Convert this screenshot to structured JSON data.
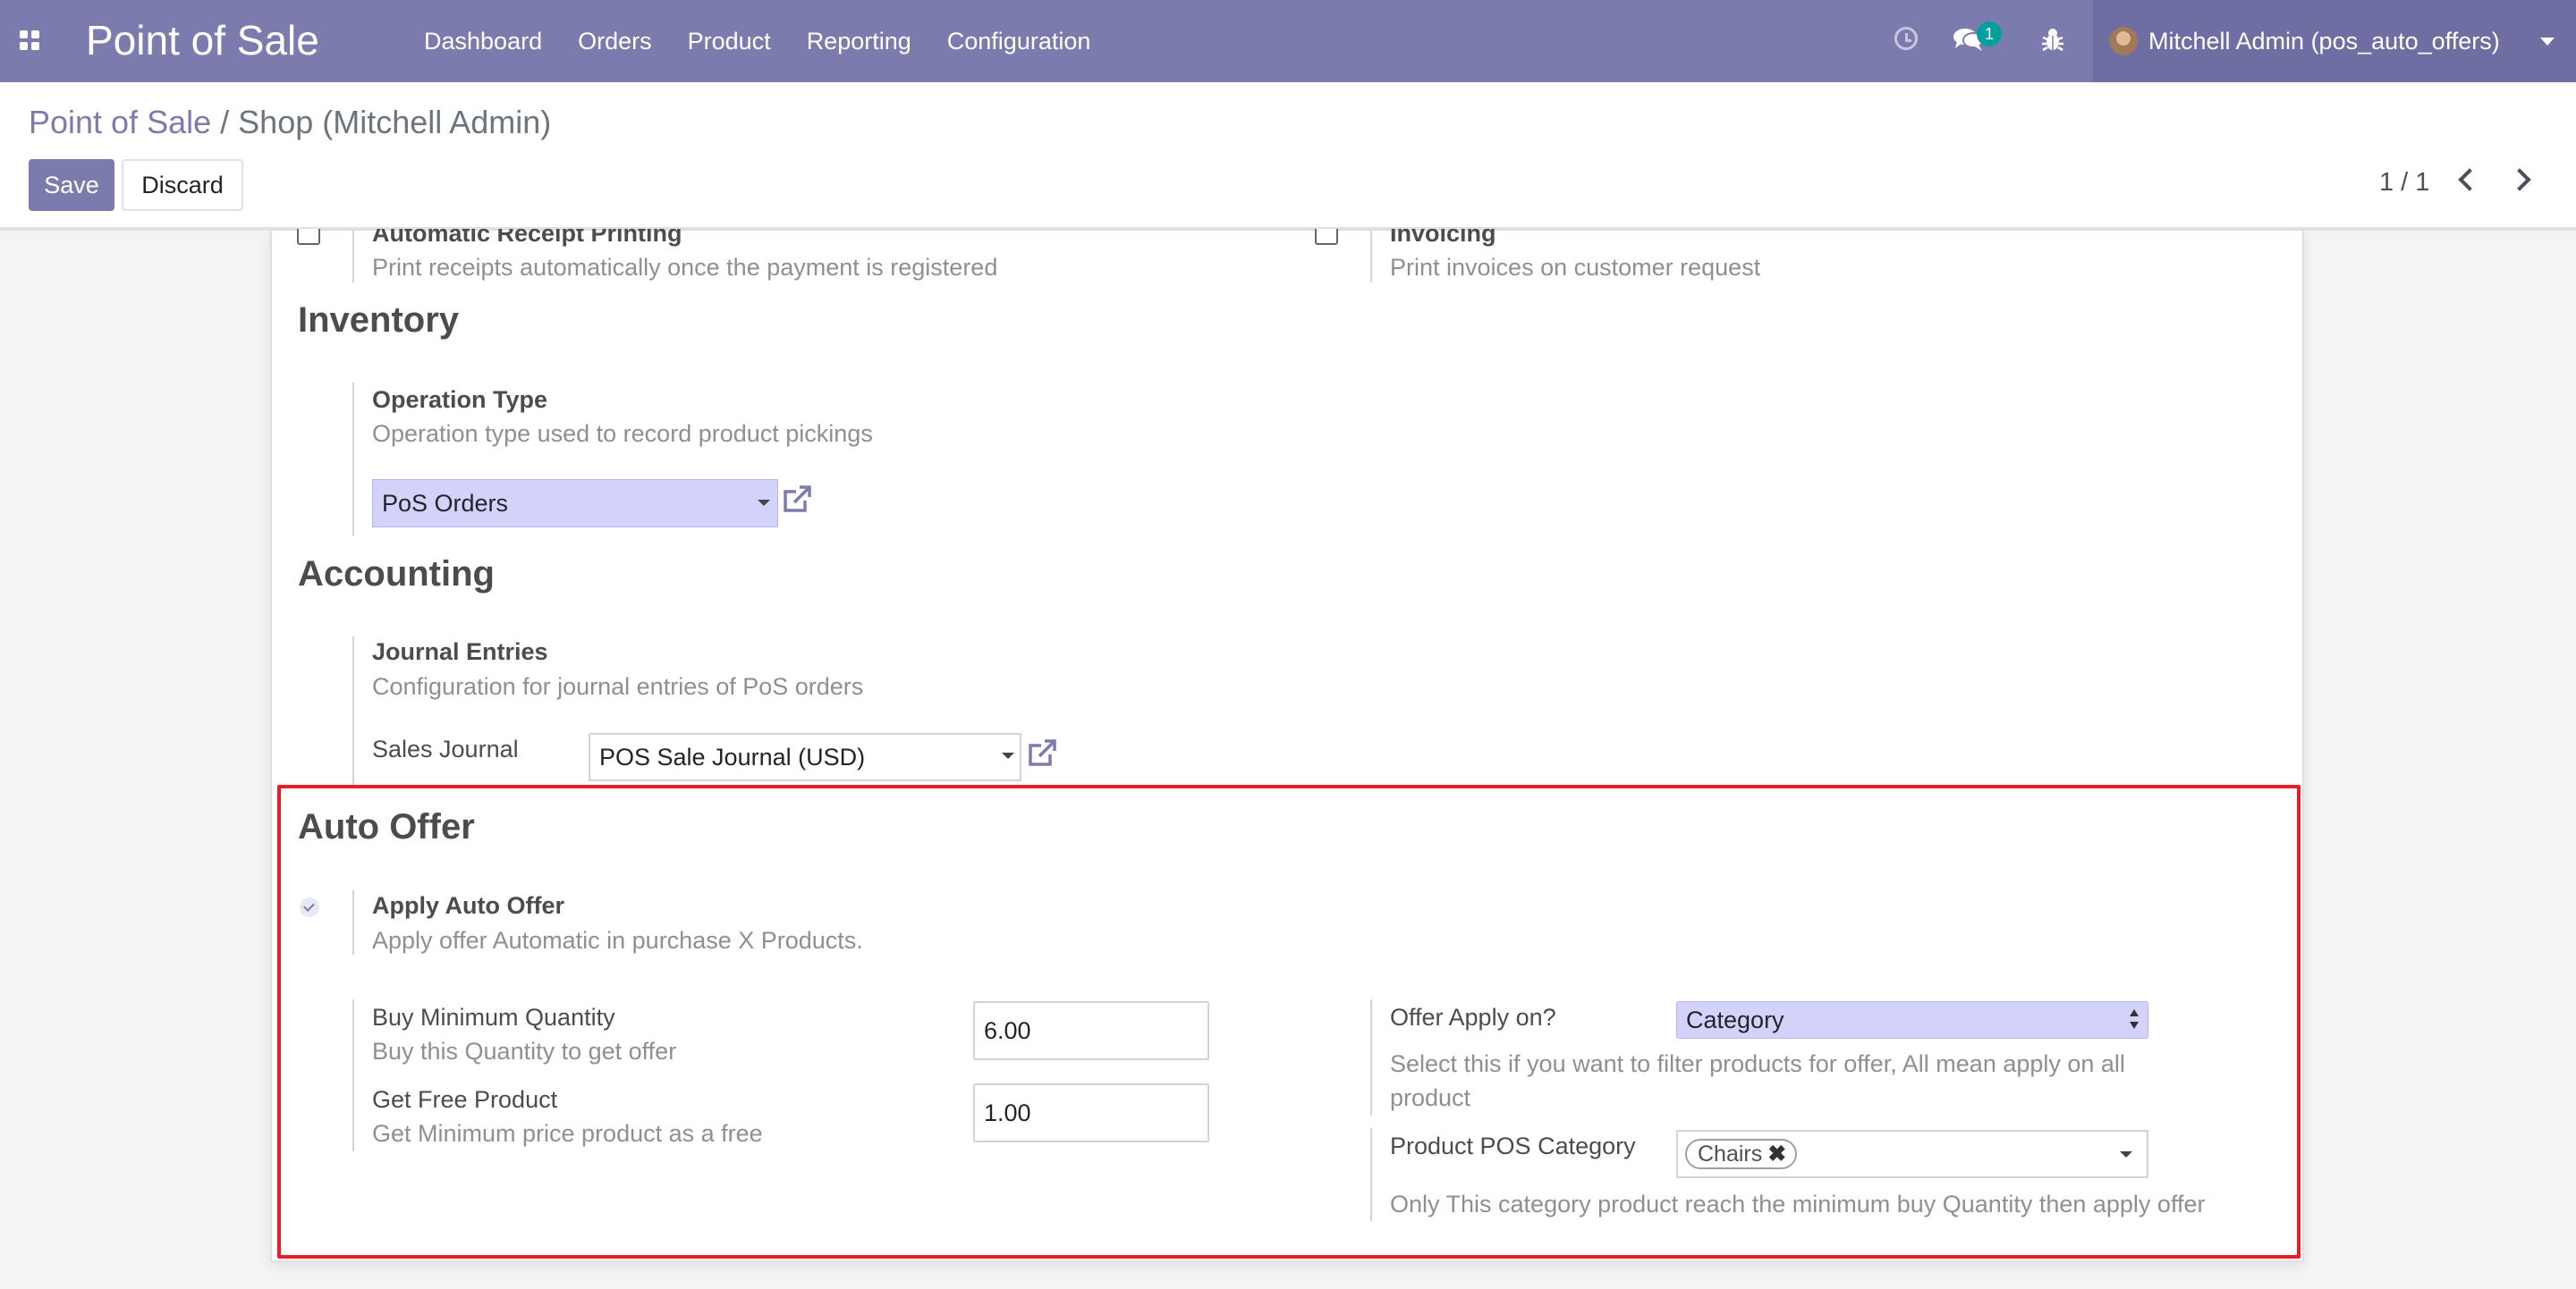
{
  "navbar": {
    "brand": "Point of Sale",
    "menu": [
      "Dashboard",
      "Orders",
      "Product",
      "Reporting",
      "Configuration"
    ],
    "messages_count": "1",
    "user_name": "Mitchell Admin (pos_auto_offers)",
    "color": "#7c7bad"
  },
  "breadcrumb": {
    "parent": "Point of Sale",
    "separator": "/",
    "current": "Shop (Mitchell Admin)"
  },
  "actions": {
    "save_label": "Save",
    "discard_label": "Discard"
  },
  "pager": {
    "value": "1 / 1"
  },
  "receipt": {
    "auto_print_title": "Automatic Receipt Printing",
    "auto_print_desc": "Print receipts automatically once the payment is registered",
    "invoicing_title": "Invoicing",
    "invoicing_desc": "Print invoices on customer request"
  },
  "inventory": {
    "section_title": "Inventory",
    "operation_type_title": "Operation Type",
    "operation_type_desc": "Operation type used to record product pickings",
    "operation_type_value": "PoS Orders"
  },
  "accounting": {
    "section_title": "Accounting",
    "journal_entries_title": "Journal Entries",
    "journal_entries_desc": "Configuration for journal entries of PoS orders",
    "sales_journal_label": "Sales Journal",
    "sales_journal_value": "POS Sale Journal (USD)"
  },
  "auto_offer": {
    "section_title": "Auto Offer",
    "apply_title": "Apply Auto Offer",
    "apply_desc": "Apply offer Automatic in purchase X Products.",
    "apply_checked": true,
    "buy_min_qty_label": "Buy Minimum Quantity",
    "buy_min_qty_desc": "Buy this Quantity to get offer",
    "buy_min_qty_value": "6.00",
    "free_product_label": "Get Free Product",
    "free_product_desc": "Get Minimum price product as a free",
    "free_product_value": "1.00",
    "offer_apply_label": "Offer Apply on?",
    "offer_apply_value": "Category",
    "offer_apply_desc_line1": "Select this if you want to filter products for offer, All mean apply on all",
    "offer_apply_desc_line2": "product",
    "pos_category_label": "Product POS Category",
    "pos_category_tag": "Chairs",
    "pos_category_desc": "Only This category product reach the minimum buy Quantity then apply offer",
    "highlight_color": "#e61e28"
  }
}
